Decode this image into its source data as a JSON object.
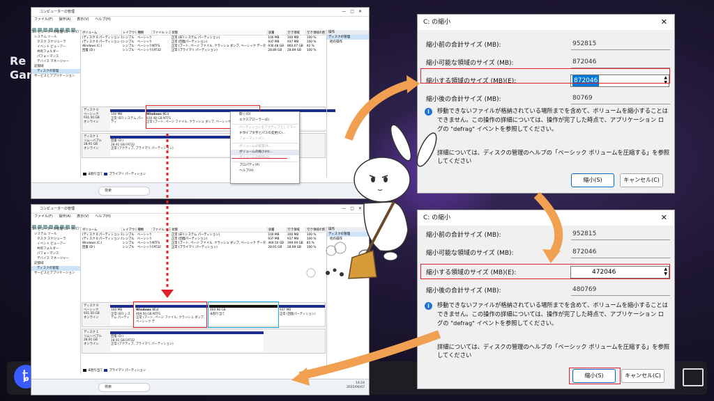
{
  "background": {
    "text_line1": "Re",
    "text_line2": "Gami"
  },
  "disk_management": {
    "title": "コンピューターの管理",
    "menu": [
      "ファイル(F)",
      "操作(A)",
      "表示(V)",
      "ヘルプ(H)"
    ],
    "tree": [
      "コンピューターの管理 (ローカル)",
      "システム ツール",
      "タスク スケジューラ",
      "イベント ビューアー",
      "共有フォルダー",
      "パフォーマンス",
      "デバイス マネージャー",
      "記憶域",
      "ディスクの管理",
      "サービスとアプリケーション"
    ],
    "columns": [
      "ボリューム",
      "レイアウト",
      "種類",
      "ファイル システム",
      "状態",
      "容量",
      "空き領域",
      "空き領域の割..."
    ],
    "rows_top": [
      [
        "(ディスク 0 パーティション 1)",
        "シンプル",
        "ベーシック",
        "",
        "正常 (EFI システム パーティション)",
        "100 MB",
        "100 MB",
        "100 %"
      ],
      [
        "(ディスク 0 パーティション 4)",
        "シンプル",
        "ベーシック",
        "",
        "正常 (回復パーティション)",
        "937 MB",
        "937 MB",
        "100 %"
      ],
      [
        "Windows (C:)",
        "シンプル",
        "ベーシック",
        "NTFS",
        "正常 (ブート, ページ ファイル, クラッシュ ダンプ, ベーシック データ パーティション)",
        "930.48 GB",
        "860.07 GB",
        "92 %"
      ],
      [
        "回復 (D:)",
        "シンプル",
        "ベーシック",
        "FAT32",
        "正常 (プライマリ パーティション)",
        "28.89 GB",
        "28.89 GB",
        "100 %"
      ]
    ],
    "rows_bottom": [
      [
        "(ディスク 0 パーティション 1)",
        "シンプル",
        "ベーシック",
        "",
        "正常 (EFI システム パーティション)",
        "100 MB",
        "100 MB",
        "100 %"
      ],
      [
        "(ディスク 0 パーティション 4)",
        "シンプル",
        "ベーシック",
        "",
        "正常 (回復パーティション)",
        "937 MB",
        "937 MB",
        "100 %"
      ],
      [
        "Windows (C:)",
        "シンプル",
        "ベーシック",
        "NTFS",
        "正常 (ブート, ページ ファイル, クラッシュ ダンプ, ベーシック データ パーティション)",
        "469.50 GB",
        "399.09 GB",
        "85 %"
      ],
      [
        "回復 (D:)",
        "シンプル",
        "ベーシック",
        "FAT32",
        "正常 (プライマリ パーティション)",
        "28.91 GB",
        "28.89 GB",
        "100 %"
      ]
    ],
    "disk0": {
      "name": "ディスク 0",
      "type": "ベーシック",
      "size": "931.50 GB",
      "status": "オンライン"
    },
    "disk1": {
      "name": "ディスク 1",
      "type": "リムーバブル",
      "size": "28.91 GB",
      "status": "オンライン"
    },
    "efi_part": {
      "size": "100 MB",
      "status": "正常 (EFI システム パーティ"
    },
    "c_part_top": {
      "name": "Windows (C:)",
      "size": "930.48 GB NTFS",
      "status": "正常 (ブート, ページ ファイル, クラッシュ ダンプ, ベーシック データ パーティション)"
    },
    "c_part_bottom": {
      "name": "Windows (C:)",
      "size": "469.50 GB NTFS",
      "status": "正常 (ブート, ページ ファイル, クラッシュ ダンプ, ベーシック デ"
    },
    "unalloc": {
      "size": "460.98 GB",
      "status": "未割り当て"
    },
    "rec_part": {
      "size": "937 MB",
      "status": "正常 (回復パーティション)"
    },
    "d_part": {
      "name": "回復 (D:)",
      "size": "28.91 GB FAT32",
      "status": "正常 (アクティブ, プライマリ パーティション)"
    },
    "legend": [
      "未割り当て",
      "プライマリ パーティション"
    ],
    "ops": {
      "header": "操作",
      "item": "ディスクの管理",
      "more": "他の操作"
    },
    "context_menu": [
      "開く(O)",
      "エクスプローラー(E)",
      "パーティションをアクティブとしてマーク(M)",
      "ドライブ文字とパスの変更(C)...",
      "フォーマット(F)...",
      "ボリュームの拡張(X)...",
      "ボリュームの縮小(H)...",
      "ボリュームの削除(D)...",
      "プロパティ(P)",
      "ヘルプ(H)"
    ],
    "taskbar": {
      "search": "検索",
      "time": "14:24",
      "date": "2025/06/07"
    }
  },
  "dialog_top": {
    "title": "C: の縮小",
    "total_before_label": "縮小前の合計サイズ (MB):",
    "total_before_value": "952815",
    "available_label": "縮小可能な領域のサイズ (MB):",
    "available_value": "872046",
    "shrink_label": "縮小する領域のサイズ (MB)(E):",
    "shrink_value": "872046",
    "after_label": "縮小後の合計サイズ (MB):",
    "after_value": "80769",
    "info": "移動できないファイルが格納されている場所までを含めて、ボリュームを縮小することはできません。この操作の詳細については、操作が完了した時点で、アプリケーション ログの \"defrag\" イベントを参照してください。",
    "help": "詳細については、ディスクの管理のヘルプの「ベーシック ボリュームを圧縮する」を参照してください",
    "shrink_button": "縮小(S)",
    "cancel_button": "キャンセル(C)"
  },
  "dialog_bottom": {
    "title": "C: の縮小",
    "total_before_label": "縮小前の合計サイズ (MB):",
    "total_before_value": "952815",
    "available_label": "縮小可能な領域のサイズ (MB):",
    "available_value": "872046",
    "shrink_label": "縮小する領域のサイズ (MB)(E):",
    "shrink_value": "472046",
    "after_label": "縮小後の合計サイズ (MB):",
    "after_value": "480769",
    "info": "移動できないファイルが格納されている場所までを含めて、ボリュームを縮小することはできません。この操作の詳細については、操作が完了した時点で、アプリケーション ログの \"defrag\" イベントを参照してください。",
    "help": "詳細については、ディスクの管理のヘルプの「ベーシック ボリュームを圧縮する」を参照してください",
    "shrink_button": "縮小(S)",
    "cancel_button": "キャンセル(C)"
  },
  "colors": {
    "highlight_red": "#e0202a",
    "arrow_orange": "#f0a050",
    "partition_blue": "#1a2d8f",
    "unalloc_box": "#2aa8e0"
  }
}
